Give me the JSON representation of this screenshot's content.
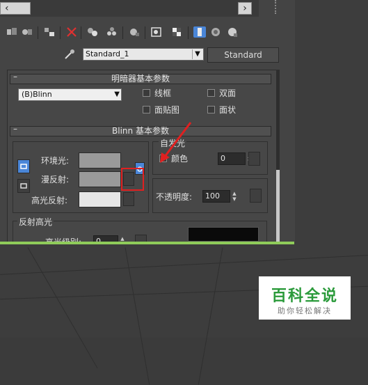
{
  "material": {
    "name": "Standard_1",
    "type_button": "Standard"
  },
  "shader_rollout": {
    "title": "明暗器基本参数",
    "shader_value": "(B)Blinn",
    "options": [
      {
        "label": "线框",
        "checked": false
      },
      {
        "label": "双面",
        "checked": false
      },
      {
        "label": "面贴图",
        "checked": false
      },
      {
        "label": "面状",
        "checked": false
      }
    ]
  },
  "blinn_rollout": {
    "title": "Blinn 基本参数",
    "ambient_label": "环境光:",
    "diffuse_label": "漫反射:",
    "specular_label": "高光反射:",
    "self_illum": {
      "title": "自发光",
      "color_label": "颜色",
      "value": "0"
    },
    "opacity": {
      "label": "不透明度:",
      "value": "100"
    },
    "specular_highlights": {
      "title": "反射高光",
      "level_label": "高光级别:",
      "level_value": "0"
    }
  },
  "watermark": {
    "title": "百科全说",
    "subtitle": "助你轻松解决"
  },
  "colors": {
    "frame_green": "#8fcc5a",
    "highlight_red": "#e02020",
    "active_blue": "#4a86d8",
    "watermark_green": "#2a9a3a"
  },
  "icons": [
    "picker-icon",
    "delete-icon",
    "show-map-icon",
    "background-icon",
    "lock-icon"
  ]
}
